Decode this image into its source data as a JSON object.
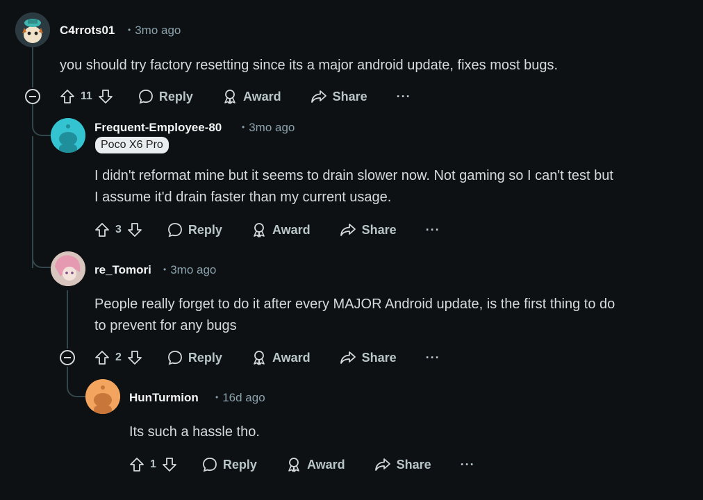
{
  "comments": [
    {
      "username": "C4rrots01",
      "time": "3mo ago",
      "text": "you should try factory resetting since its a major android update, fixes most bugs.",
      "votes": "11",
      "reply": "Reply",
      "award": "Award",
      "share": "Share",
      "more": "···"
    },
    {
      "username": "Frequent-Employee-80",
      "time": "3mo ago",
      "flair": "Poco X6 Pro",
      "text_line1": "I didn't reformat mine but it seems to drain slower now. Not gaming so I can't test but",
      "text_line2": "I assume it'd drain faster than my current usage.",
      "votes": "3",
      "reply": "Reply",
      "award": "Award",
      "share": "Share",
      "more": "···"
    },
    {
      "username": "re_Tomori",
      "time": "3mo ago",
      "text_line1": "People really forget to do it after every MAJOR Android update, is the first thing to do",
      "text_line2": "to prevent for any bugs",
      "votes": "2",
      "reply": "Reply",
      "award": "Award",
      "share": "Share",
      "more": "···"
    },
    {
      "username": "HunTurmion",
      "time": "16d ago",
      "text": "Its such a hassle tho.",
      "votes": "1",
      "reply": "Reply",
      "award": "Award",
      "share": "Share",
      "more": "···"
    }
  ],
  "colors": {
    "background": "#0e1113",
    "text": "#d7dadc",
    "meta": "#8ba2ad",
    "thread_line": "#33464c"
  }
}
